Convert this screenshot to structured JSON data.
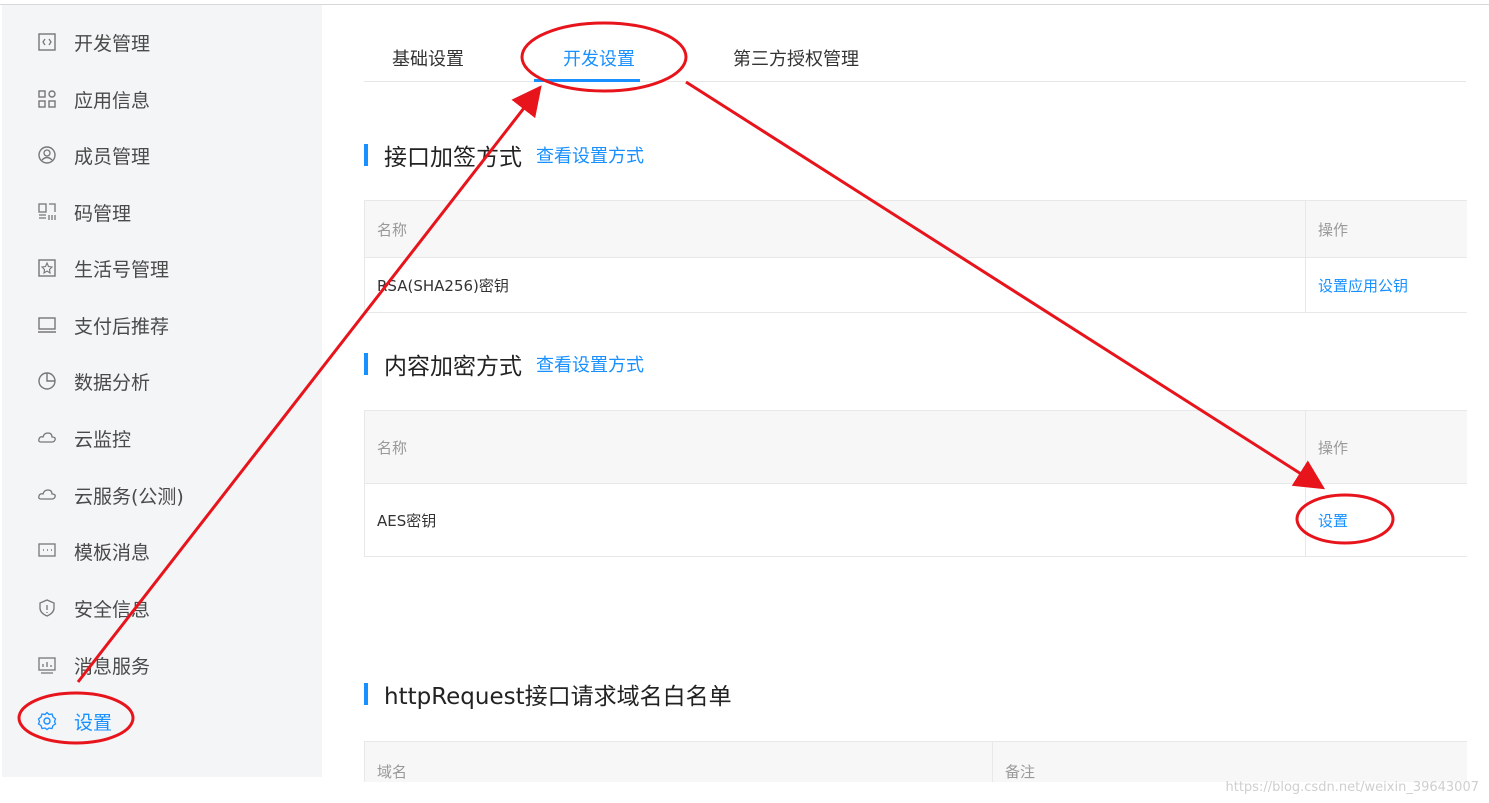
{
  "sidebar": {
    "items": [
      {
        "label": "开发管理",
        "icon": "code-icon"
      },
      {
        "label": "应用信息",
        "icon": "apps-icon"
      },
      {
        "label": "成员管理",
        "icon": "user-icon"
      },
      {
        "label": "码管理",
        "icon": "qrcode-icon"
      },
      {
        "label": "生活号管理",
        "icon": "star-icon"
      },
      {
        "label": "支付后推荐",
        "icon": "monitor-icon"
      },
      {
        "label": "数据分析",
        "icon": "pie-chart-icon"
      },
      {
        "label": "云监控",
        "icon": "cloud-icon"
      },
      {
        "label": "云服务(公测)",
        "icon": "cloud-icon"
      },
      {
        "label": "模板消息",
        "icon": "message-icon"
      },
      {
        "label": "安全信息",
        "icon": "shield-icon"
      },
      {
        "label": "消息服务",
        "icon": "chart-board-icon"
      },
      {
        "label": "设置",
        "icon": "gear-icon"
      }
    ],
    "active_index": 12
  },
  "tabs": [
    {
      "label": "基础设置"
    },
    {
      "label": "开发设置"
    },
    {
      "label": "第三方授权管理"
    }
  ],
  "active_tab": 1,
  "sections": {
    "signing": {
      "title": "接口加签方式",
      "link": "查看设置方式",
      "header_name": "名称",
      "header_action": "操作",
      "row_name": "RSA(SHA256)密钥",
      "row_action": "设置应用公钥"
    },
    "encryption": {
      "title": "内容加密方式",
      "link": "查看设置方式",
      "header_name": "名称",
      "header_action": "操作",
      "row_name": "AES密钥",
      "row_action": "设置"
    },
    "whitelist": {
      "title": "httpRequest接口请求域名白名单",
      "header_domain": "域名",
      "header_note": "备注"
    }
  },
  "annotation_color": "#e8141c",
  "accent_color": "#1890ff",
  "watermark": "https://blog.csdn.net/weixin_39643007"
}
